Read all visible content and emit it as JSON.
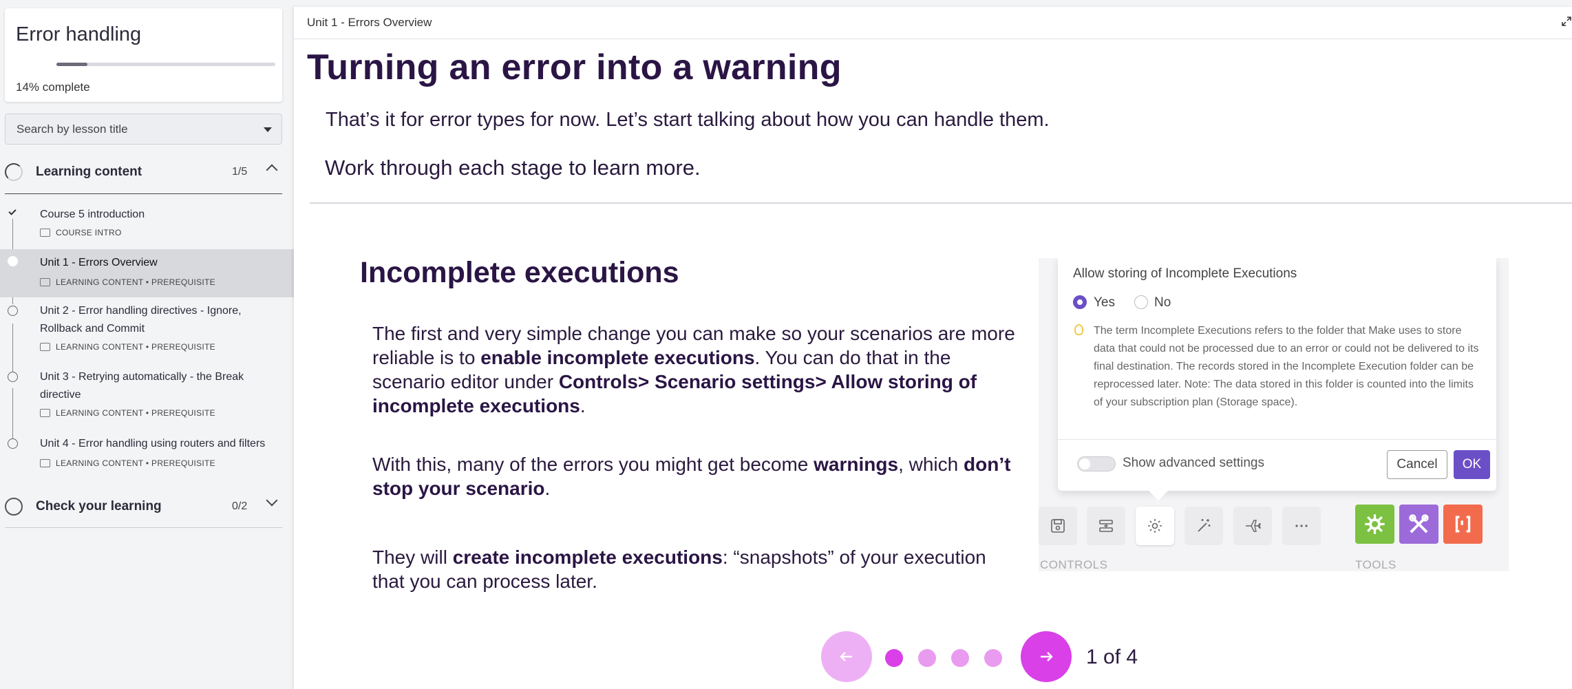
{
  "sidebar": {
    "course_title": "Error handling",
    "progress_percent": 14,
    "progress_value": "14%",
    "progress_suffix": " complete",
    "search_placeholder": "Search by lesson title",
    "sections": [
      {
        "label": "Learning content",
        "count": "1/5",
        "expanded": true,
        "lessons": [
          {
            "title": "Course 5 introduction",
            "meta": "COURSE INTRO",
            "status": "complete"
          },
          {
            "title": "Unit 1 - Errors Overview",
            "meta": "LEARNING CONTENT • PREREQUISITE",
            "status": "active"
          },
          {
            "title": "Unit 2 - Error handling directives - Ignore, Rollback and Commit",
            "meta": "LEARNING CONTENT • PREREQUISITE",
            "status": "incomplete"
          },
          {
            "title": "Unit 3 - Retrying automatically - the Break directive",
            "meta": "LEARNING CONTENT • PREREQUISITE",
            "status": "incomplete"
          },
          {
            "title": "Unit 4 - Error handling using routers and filters",
            "meta": "LEARNING CONTENT • PREREQUISITE",
            "status": "incomplete"
          }
        ]
      },
      {
        "label": "Check your learning",
        "count": "0/2",
        "expanded": false
      }
    ]
  },
  "main": {
    "breadcrumb": "Unit 1 - Errors Overview",
    "title": "Turning an error into a warning",
    "intro": [
      "That’s it for error types for now. Let’s start talking about how you can handle them.",
      "Work through each stage to learn more."
    ],
    "slide": {
      "title": "Incomplete executions",
      "p1": {
        "a": "The first and very simple change you can make so your scenarios are more reliable is to ",
        "b": "enable incomplete executions",
        "c": ". You can do that in the scenario editor under ",
        "d": "Controls> Scenario settings> Allow storing of incomplete executions",
        "e": "."
      },
      "p2": {
        "a": "With this, many of the errors you might get become ",
        "b": "warnings",
        "c": ", which ",
        "d": "don’t stop your scenario",
        "e": "."
      },
      "p3": {
        "a": "They will ",
        "b": "create incomplete executions",
        "c": ": “snapshots” of your execution that you can process later."
      }
    },
    "screenshot": {
      "dialog_title": "Allow storing of Incomplete Executions",
      "option_yes": "Yes",
      "option_no": "No",
      "selected": "Yes",
      "hint": "The term Incomplete Executions refers to the folder that Make uses to store data that could not be processed due to an error or could not be delivered to its final destination. The records stored in the Incomplete Execution folder can be reprocessed later. Note: The data stored in this folder is counted into the limits of your subscription plan (Storage space).",
      "advanced_label": "Show advanced settings",
      "cancel_label": "Cancel",
      "ok_label": "OK",
      "controls_label": "CONTROLS",
      "tools_label": "TOOLS",
      "control_icons": [
        "save-icon",
        "scenario-io-icon",
        "gear-icon",
        "magic-wand-icon",
        "airplane-icon",
        "more-icon"
      ],
      "tool_icons": [
        "tools-gear-icon",
        "tools-wrench-icon",
        "tools-bracket-icon"
      ],
      "tool_colors": [
        "#7cc142",
        "#9c6bd9",
        "#f26b4c"
      ]
    },
    "pager": {
      "current": 1,
      "total": 4,
      "label": "1 of 4"
    }
  },
  "colors": {
    "accent_magenta": "#d940e8",
    "accent_light": "#eeb0f4",
    "heading": "#2a1545",
    "make_purple": "#6b4fc7"
  }
}
